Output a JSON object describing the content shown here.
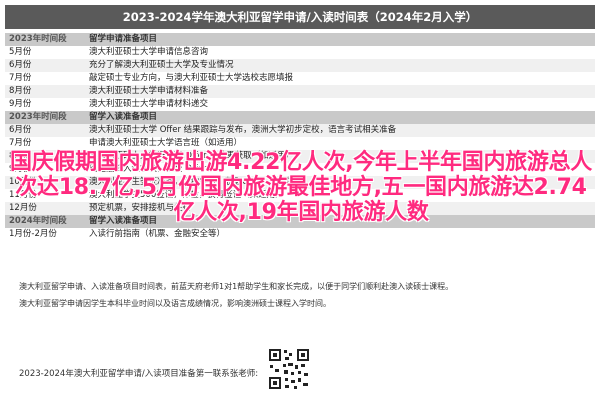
{
  "title": "2023-2024学年澳大利亚留学申请/入读时间表（2024年2月入学）",
  "rows": [
    {
      "section": true,
      "period": "2023年时间段",
      "task": "留学申请准备项目"
    },
    {
      "period": "5月份",
      "task": "澳大利亚硕士大学申请信息咨询"
    },
    {
      "period": "6月份",
      "task": "充分了解澳大利亚硕士大学及专业情况"
    },
    {
      "period": "7月份",
      "task": "敲定硕士专业方向，与澳大利亚硕士大学选校志愿填报"
    },
    {
      "period": "8月份",
      "task": "澳大利亚硕士大学申请材料准备"
    },
    {
      "period": "9月份",
      "task": "澳大利亚硕士大学申请材料递交"
    },
    {
      "section": true,
      "period": "2023年时间段",
      "task": "留学入读准备项目"
    },
    {
      "period": "6月份",
      "task": "澳大利亚硕士大学 Offer 结果跟踪与发布，澳洲大学初步定校，语言考试相关准备"
    },
    {
      "period": "7月份",
      "task": "申请澳大利亚硕士大学语言班（如适用）"
    },
    {
      "period": "8月份",
      "task": "澳大利亚硕士大学语言班 Offer 预结果获取（如适用）"
    },
    {
      "period": "9月份",
      "task": "确定最终入读学校，接受 Offer"
    },
    {
      "period": "10月份",
      "task": "澳大利亚学生签证准备，缴纳学费，获取COE，确认住宿"
    },
    {
      "period": "11月份",
      "task": "澳大利亚学生500签证，体检，获得签证（如适用）"
    },
    {
      "period": "12月份",
      "task": "预定机票，安排接机与住宿"
    },
    {
      "section": true,
      "period": "2024年时间段",
      "task": "留学入读准备项目"
    },
    {
      "period": "1月份-2月份",
      "task": "入读行前指南（机票、金融安全等）"
    }
  ],
  "notes": [
    "澳大利亚留学申请、入读准备项目时间表，前蓝天府老师1对1帮助学生和家长完成，以便于同学们顺利赴澳入读硕士课程。",
    "澳大利亚留学申请因学生本科毕业时间以及语言成绩情况，影响澳洲硕士课程入学时间。"
  ],
  "footer": "2023-2024年澳大利亚留学申请/入读项目准备第一联系张老师:",
  "overlay": "国庆假期国内旅游出游4.22亿人次,今年上半年国内旅游总人次达18.7亿,5月份国内旅游最佳地方,五一国内旅游达2.74亿人次,19年国内旅游人数",
  "colors": {
    "title_bg": "#5a5a5a",
    "section_bg": "#c9c9c9",
    "overlay": "#ff2a7f"
  }
}
